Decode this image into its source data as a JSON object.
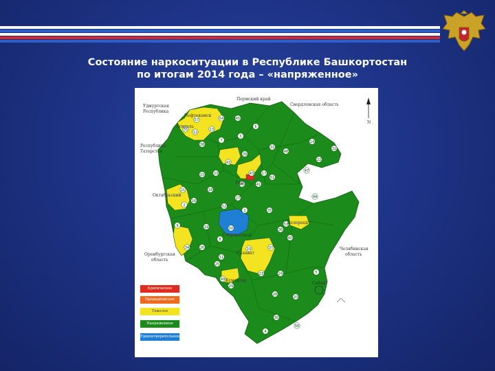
{
  "title": {
    "line1": "Состояние наркоситуации в Республике Башкортостан",
    "line2": "по итогам 2014 года – «напряженное»"
  },
  "colors": {
    "background": "#1e3488",
    "green": "#1b8c1b",
    "yellow": "#f4e321",
    "blue": "#1f7fd4",
    "red": "#e22b1f",
    "orange": "#f06a1e"
  },
  "icons": {
    "emblem": "double-headed-eagle-emblem",
    "north": "north-arrow-icon"
  },
  "map": {
    "north_label": "N",
    "neighbors": {
      "perm": "Пермский край",
      "sverdlovsk": "Свердловская область",
      "udmurt_1": "Удмуртская",
      "udmurt_2": "Республика",
      "tatarstan_1": "Республика",
      "tatarstan_2": "Татарстан",
      "orenburg_1": "Оренбургская",
      "orenburg_2": "область",
      "chelyabinsk_1": "Челябинская",
      "chelyabinsk_2": "область"
    },
    "cities": {
      "neftekamsk": "Нефтекамск",
      "agidel": "Агидель",
      "ufa": "Уфа",
      "oktyabrsky": "Октябрьский",
      "sterlitamak": "Стерлитамак",
      "salavat": "Салават",
      "kumertau": "Кумертау",
      "beloretsk": "Белорецк",
      "sibay": "Сибай"
    },
    "region_numbers": [
      "57",
      "54",
      "45",
      "55",
      "12",
      "13",
      "6",
      "3",
      "7",
      "38",
      "31",
      "48",
      "14",
      "39",
      "42",
      "22",
      "47",
      "32",
      "17",
      "43",
      "33",
      "15",
      "41",
      "46",
      "18",
      "21",
      "16",
      "52",
      "35",
      "1",
      "2",
      "19",
      "50",
      "34",
      "26",
      "9",
      "11",
      "36",
      "40",
      "37",
      "10",
      "8",
      "53",
      "25",
      "49",
      "23",
      "24",
      "44",
      "28",
      "20",
      "30",
      "56",
      "4",
      "5",
      "27",
      "51",
      "29"
    ],
    "legend": [
      "Критическое",
      "Предкризисное",
      "Тяжелое",
      "Напряженное",
      "Удовлетворительное"
    ]
  }
}
